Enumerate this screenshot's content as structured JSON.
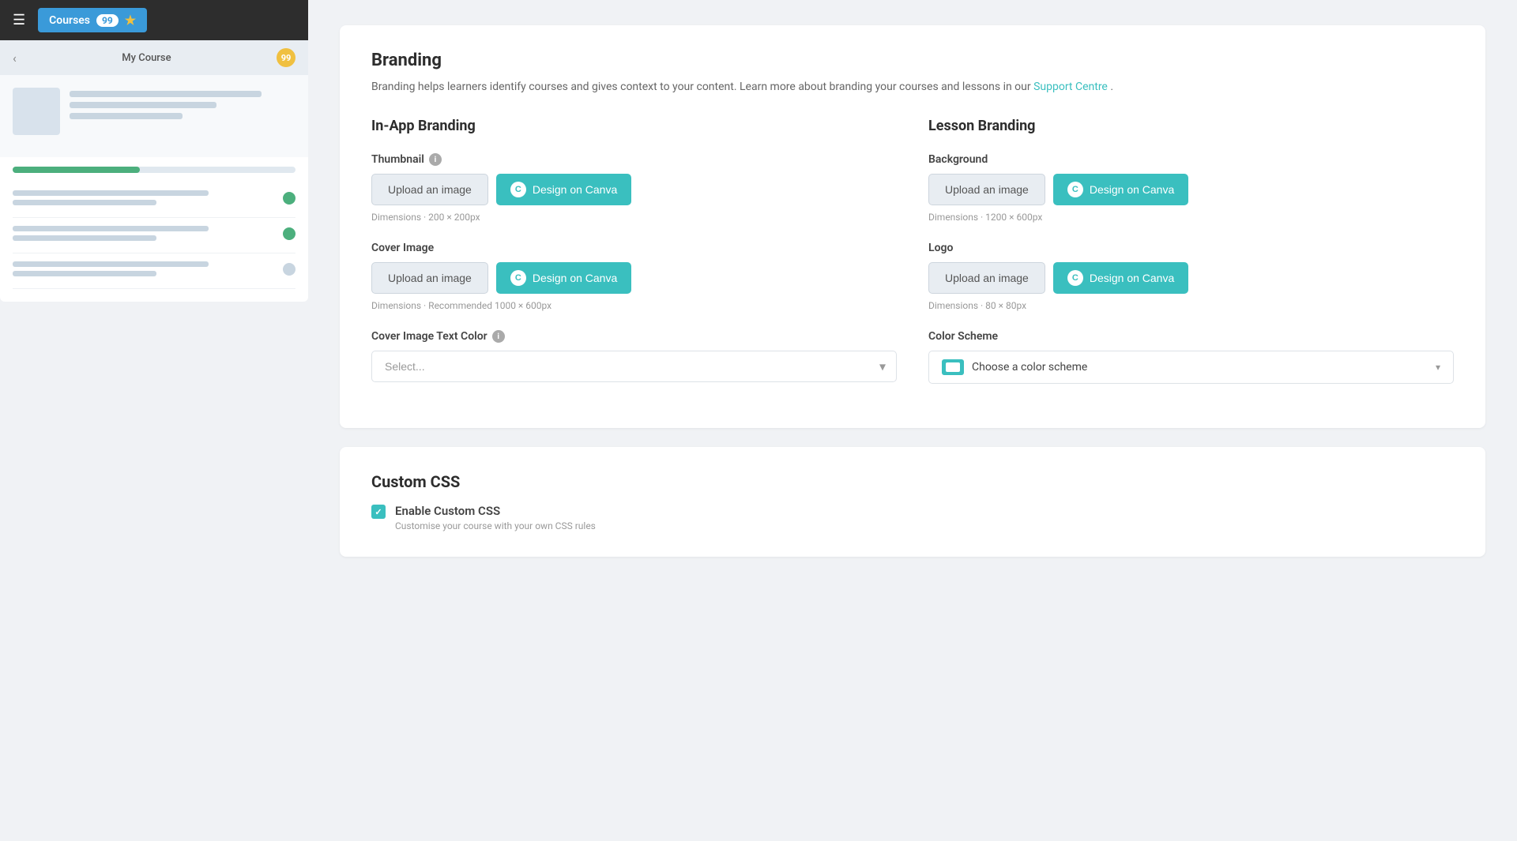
{
  "sidebar": {
    "header": {
      "courses_label": "Courses",
      "badge_count": "99",
      "star": "★"
    },
    "course": {
      "back_arrow": "‹",
      "title": "My Course",
      "badge": "99"
    },
    "progress_percent": 45
  },
  "branding": {
    "title": "Branding",
    "description_part1": "Branding helps learners identify courses and gives context to your content. Learn more about branding your courses and lessons in our ",
    "description_link": "Support Centre",
    "description_part2": ".",
    "in_app": {
      "title": "In-App Branding",
      "thumbnail": {
        "label": "Thumbnail",
        "upload_btn": "Upload an image",
        "canva_btn": "Design on Canva",
        "dimensions": "Dimensions · 200 × 200px"
      },
      "cover_image": {
        "label": "Cover Image",
        "upload_btn": "Upload an image",
        "canva_btn": "Design on Canva",
        "dimensions": "Dimensions · Recommended 1000 × 600px"
      },
      "cover_text_color": {
        "label": "Cover Image Text Color",
        "placeholder": "Select..."
      }
    },
    "lesson": {
      "title": "Lesson Branding",
      "background": {
        "label": "Background",
        "upload_btn": "Upload an image",
        "canva_btn": "Design on Canva",
        "dimensions": "Dimensions · 1200 × 600px"
      },
      "logo": {
        "label": "Logo",
        "upload_btn": "Upload an image",
        "canva_btn": "Design on Canva",
        "dimensions": "Dimensions · 80 × 80px"
      },
      "color_scheme": {
        "label": "Color Scheme",
        "placeholder": "Choose a color scheme"
      }
    }
  },
  "custom_css": {
    "title": "Custom CSS",
    "enable_label": "Enable Custom CSS",
    "enable_sublabel": "Customise your course with your own CSS rules"
  },
  "colors": {
    "teal": "#3abfbf",
    "green": "#4caf7d",
    "dark": "#2d2d2d"
  }
}
